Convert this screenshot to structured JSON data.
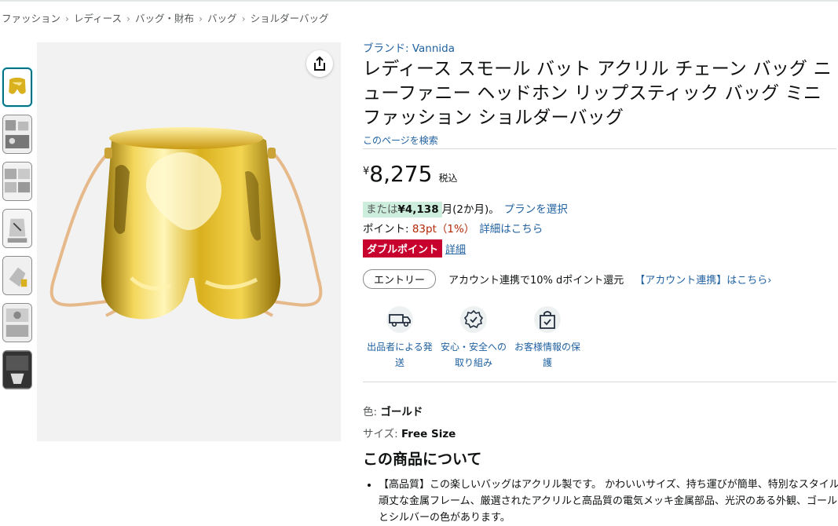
{
  "breadcrumb": [
    "ファッション",
    "レディース",
    "バッグ・財布",
    "バッグ",
    "ショルダーバッグ"
  ],
  "gallery": {
    "thumb_count": 7,
    "share_icon": "share-icon"
  },
  "product": {
    "brand": "ブランド: Vannida",
    "title": "レディース スモール バット アクリル チェーン バッグ ニューファニー ヘッドホン リップスティック バッグ ミニ ファッション ショルダーバッグ",
    "search_link": "このページを検索"
  },
  "price": {
    "currency": "¥",
    "amount": "8,275",
    "tax_label": "税込"
  },
  "installment": {
    "prefix": "または",
    "amount": "¥4,138",
    "suffix": "月(2か月)。",
    "link": "プランを選択"
  },
  "points": {
    "label": "ポイント: ",
    "value": "83pt（1%）",
    "link": "詳細はこちら"
  },
  "double_point": {
    "badge": "ダブルポイント",
    "link": "詳細"
  },
  "entry": {
    "button": "エントリー",
    "text": "アカウント連携で10% dポイント還元",
    "link": "【アカウント連携】はこちら›"
  },
  "features": [
    {
      "icon": "truck-icon",
      "label": "出品者による発送"
    },
    {
      "icon": "shield-check-icon",
      "label": "安心・安全への取り組み"
    },
    {
      "icon": "secure-bag-icon",
      "label": "お客様情報の保護"
    }
  ],
  "variations": {
    "color_label": "色: ",
    "color_value": "ゴールド",
    "size_label": "サイズ: ",
    "size_value": "Free Size"
  },
  "about": {
    "heading": "この商品について",
    "bullets": [
      "【高品質】この楽しいバッグはアクリル製です。 かわいいサイズ、持ち運びが簡単、特別なスタイル、頑丈な金属フレーム、厳選されたアクリルと高品質の電気メッキ金属部品、光沢のある外観、ゴールドとシルバーの色があります。"
    ]
  },
  "colors": {
    "link": "#2162a1",
    "price_red": "#b12704",
    "badge_red": "#c7002d",
    "gold": "#d9b01e"
  }
}
